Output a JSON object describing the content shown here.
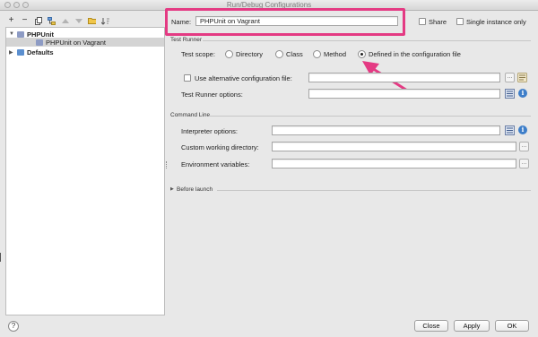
{
  "window": {
    "title": "Run/Debug Configurations"
  },
  "toolbar": {
    "icons": [
      "add-icon",
      "remove-icon",
      "copy-icon",
      "settings-icon",
      "move-up-icon",
      "move-down-icon",
      "folder-icon",
      "sort-icon"
    ],
    "add_glyph": "+",
    "remove_glyph": "−"
  },
  "tree": {
    "nodes": [
      {
        "label": "PHPUnit",
        "expanded": true,
        "icon": "phpunit-icon"
      },
      {
        "label": "PHPUnit on Vagrant",
        "selected": true,
        "icon": "phpunit-config-icon"
      },
      {
        "label": "Defaults",
        "expanded": false,
        "icon": "defaults-icon"
      }
    ],
    "expanded_glyph": "▼",
    "collapsed_glyph": "▶"
  },
  "name_row": {
    "label": "Name:",
    "value": "PHPUnit on Vagrant",
    "share_label": "Share",
    "share_checked": false,
    "single_instance_label": "Single instance only",
    "single_instance_checked": false,
    "highlight_color": "#e43a83"
  },
  "test_runner": {
    "section_title": "Test Runner",
    "scope_label": "Test scope:",
    "scopes": [
      {
        "label": "Directory",
        "selected": false
      },
      {
        "label": "Class",
        "selected": false
      },
      {
        "label": "Method",
        "selected": false
      },
      {
        "label": "Defined in the configuration file",
        "selected": true
      }
    ],
    "alt_config_label": "Use alternative configuration file:",
    "alt_config_checked": false,
    "alt_config_value": "",
    "runner_options_label": "Test Runner options:",
    "runner_options_value": ""
  },
  "command_line": {
    "section_title": "Command Line",
    "interpreter_label": "Interpreter options:",
    "interpreter_value": "",
    "working_dir_label": "Custom working directory:",
    "working_dir_value": "",
    "env_label": "Environment variables:",
    "env_value": ""
  },
  "before_launch": {
    "label": "Before launch",
    "expanded": false
  },
  "buttons": {
    "close": "Close",
    "apply": "Apply",
    "ok": "OK",
    "help": "?"
  },
  "misc": {
    "ellipsis": "...",
    "info_glyph": "i"
  },
  "annotation": {
    "arrow_color": "#e43a83"
  }
}
